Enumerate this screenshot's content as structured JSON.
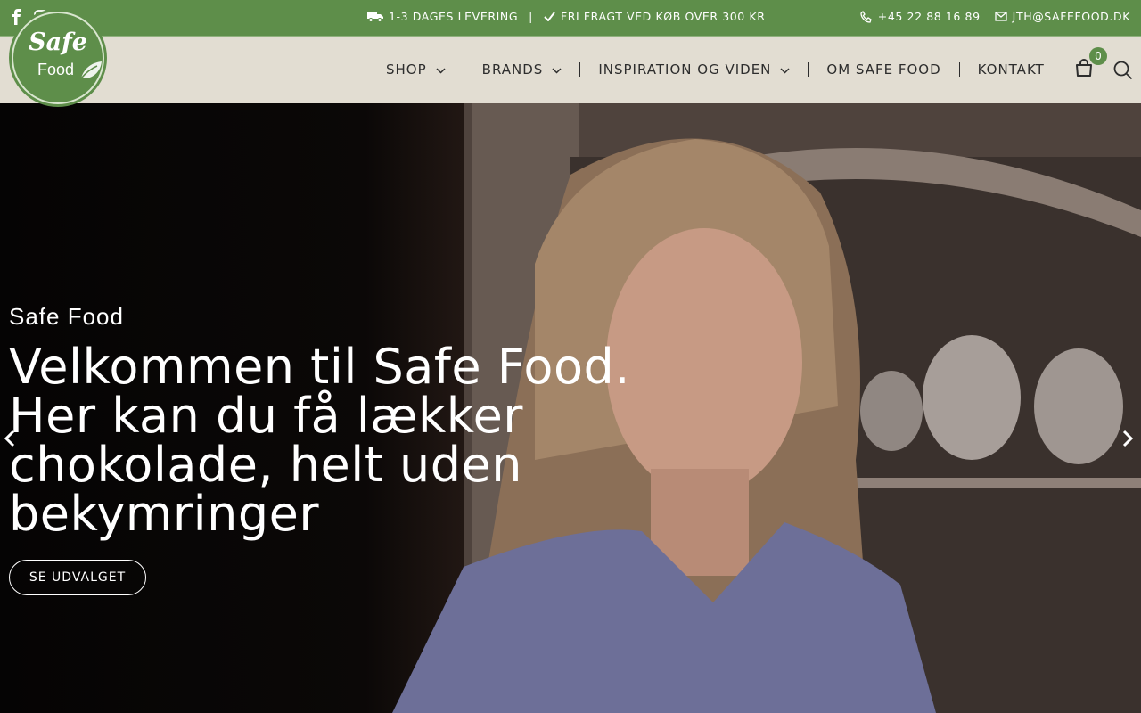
{
  "topbar": {
    "social": [
      "facebook-icon",
      "instagram-icon"
    ],
    "delivery": "1-3 DAGES LEVERING",
    "separator": "|",
    "free_shipping": "FRI FRAGT VED KØB OVER 300 KR",
    "phone": "+45 22 88 16 89",
    "email": "JTH@SAFEFOOD.DK",
    "bg_color": "#5e8e4a"
  },
  "logo": {
    "line1": "Safe",
    "line2": "Food"
  },
  "nav": {
    "items": [
      {
        "label": "SHOP",
        "has_dropdown": true
      },
      {
        "label": "BRANDS",
        "has_dropdown": true
      },
      {
        "label": "INSPIRATION OG VIDEN",
        "has_dropdown": true
      },
      {
        "label": "OM SAFE FOOD",
        "has_dropdown": false
      },
      {
        "label": "KONTAKT",
        "has_dropdown": false
      }
    ],
    "cart_count": "0"
  },
  "hero": {
    "subtitle": "Safe Food",
    "title_lines": [
      "Velkommen til Safe Food.",
      "Her kan du få lækker",
      "chokolade, helt uden",
      "bekymringer"
    ],
    "cta_label": "SE UDVALGET"
  }
}
